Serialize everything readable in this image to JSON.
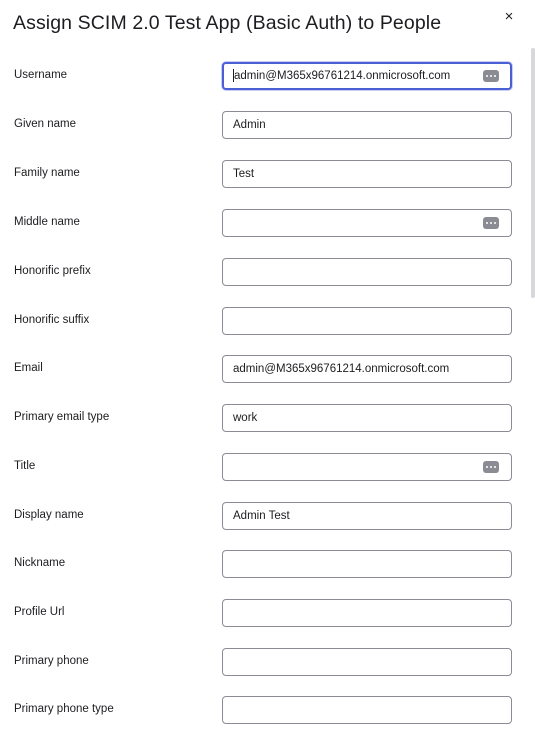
{
  "dialog": {
    "title": "Assign SCIM 2.0 Test App (Basic Auth) to People",
    "close_label": "×"
  },
  "fields": [
    {
      "label": "Username",
      "value": "admin@M365x96761214.onmicrosoft.com",
      "has_menu_icon": true,
      "focused": true
    },
    {
      "label": "Given name",
      "value": "Admin"
    },
    {
      "label": "Family name",
      "value": "Test"
    },
    {
      "label": "Middle name",
      "value": "",
      "has_menu_icon": true
    },
    {
      "label": "Honorific prefix",
      "value": ""
    },
    {
      "label": "Honorific suffix",
      "value": ""
    },
    {
      "label": "Email",
      "value": "admin@M365x96761214.onmicrosoft.com"
    },
    {
      "label": "Primary email type",
      "value": "work"
    },
    {
      "label": "Title",
      "value": "",
      "has_menu_icon": true
    },
    {
      "label": "Display name",
      "value": "Admin Test"
    },
    {
      "label": "Nickname",
      "value": ""
    },
    {
      "label": "Profile Url",
      "value": ""
    },
    {
      "label": "Primary phone",
      "value": ""
    },
    {
      "label": "Primary phone type",
      "value": ""
    }
  ],
  "icons": {
    "close": "close-icon",
    "field_menu": "ellipsis-icon"
  },
  "colors": {
    "focus_border": "#4b5fd4",
    "input_border": "#8c8c96",
    "text": "#1d1d21"
  }
}
